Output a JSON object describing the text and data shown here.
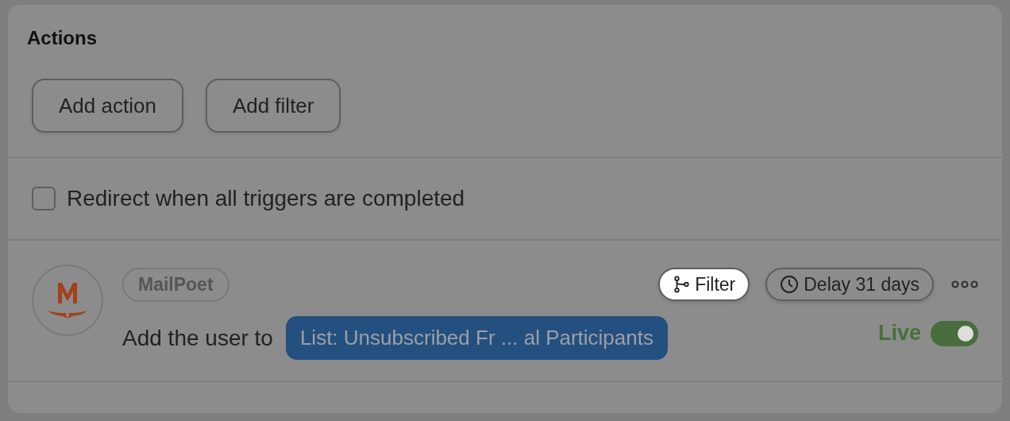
{
  "section": {
    "title": "Actions"
  },
  "buttons": [
    "Add action",
    "Add filter"
  ],
  "redirect": {
    "label": "Redirect when all triggers are completed",
    "checked": false
  },
  "action": {
    "tag": "MailPoet",
    "text": "Add the user to",
    "list": "List: Unsubscribed Fr ... al Participants",
    "pills": [
      {
        "kind": "filter",
        "label": "Filter",
        "highlighted": true
      },
      {
        "kind": "delay",
        "label": "Delay 31 days",
        "highlighted": false
      }
    ],
    "status": {
      "label": "Live",
      "on": true
    }
  }
}
